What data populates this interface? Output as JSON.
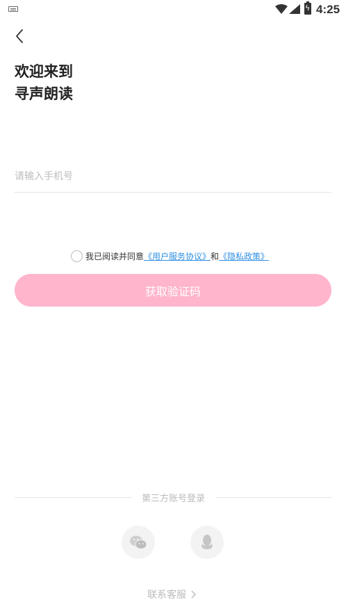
{
  "status_bar": {
    "time": "4:25",
    "icons": [
      "keyboard-icon",
      "wifi-icon",
      "signal-icon",
      "battery-charging-icon"
    ]
  },
  "header": {
    "back_icon": "chevron-left-icon"
  },
  "welcome": {
    "line1": "欢迎来到",
    "line2": "寻声朗读"
  },
  "phone_input": {
    "value": "",
    "placeholder": "请输入手机号"
  },
  "agreement": {
    "checked": false,
    "prefix": "我已阅读并同意",
    "terms_link": "《用户服务协议》",
    "connector": "和",
    "privacy_link": "《隐私政策》"
  },
  "primary_button": {
    "label": "获取验证码",
    "color": "#ffb5cc"
  },
  "third_party": {
    "label": "第三方账号登录",
    "providers": [
      "wechat-icon",
      "qq-icon"
    ]
  },
  "footer": {
    "contact_label": "联系客服"
  },
  "colors": {
    "link": "#2f8fe3",
    "accent_pink": "#ffb5cc"
  }
}
